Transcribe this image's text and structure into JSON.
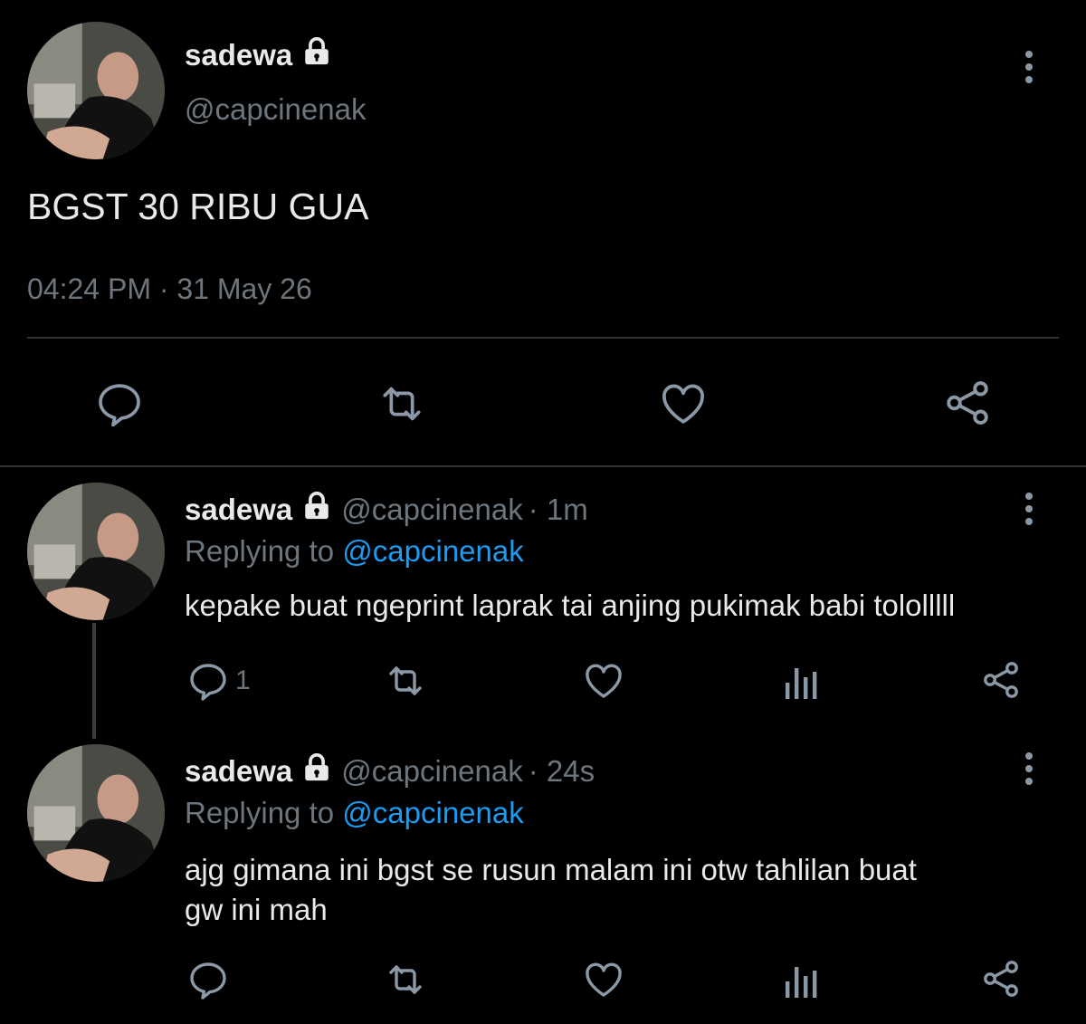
{
  "main_tweet": {
    "display_name": "sadewa",
    "handle": "@capcinenak",
    "text": "BGST 30 RIBU GUA",
    "timestamp": "04:24 PM · 31 May 26",
    "actions": [
      "reply-icon",
      "retweet-icon",
      "like-icon",
      "share-icon"
    ]
  },
  "replies": [
    {
      "display_name": "sadewa",
      "handle": "@capcinenak",
      "time": "· 1m",
      "replying_label": "Replying to",
      "replying_to": "@capcinenak",
      "text": "kepake buat ngeprint laprak tai anjing pukimak babi tololllll",
      "reply_count": "1"
    },
    {
      "display_name": "sadewa",
      "handle": "@capcinenak",
      "time": "· 24s",
      "replying_label": "Replying to",
      "replying_to": "@capcinenak",
      "text_line1": "ajg gimana ini bgst se rusun malam ini otw tahlilan buat",
      "text_line2": "gw ini mah",
      "reply_count": ""
    }
  ],
  "colors": {
    "background": "#000000",
    "text": "#e7e9ea",
    "muted": "#6e767d",
    "link": "#1d9bf0",
    "icon": "#8b98a5"
  }
}
